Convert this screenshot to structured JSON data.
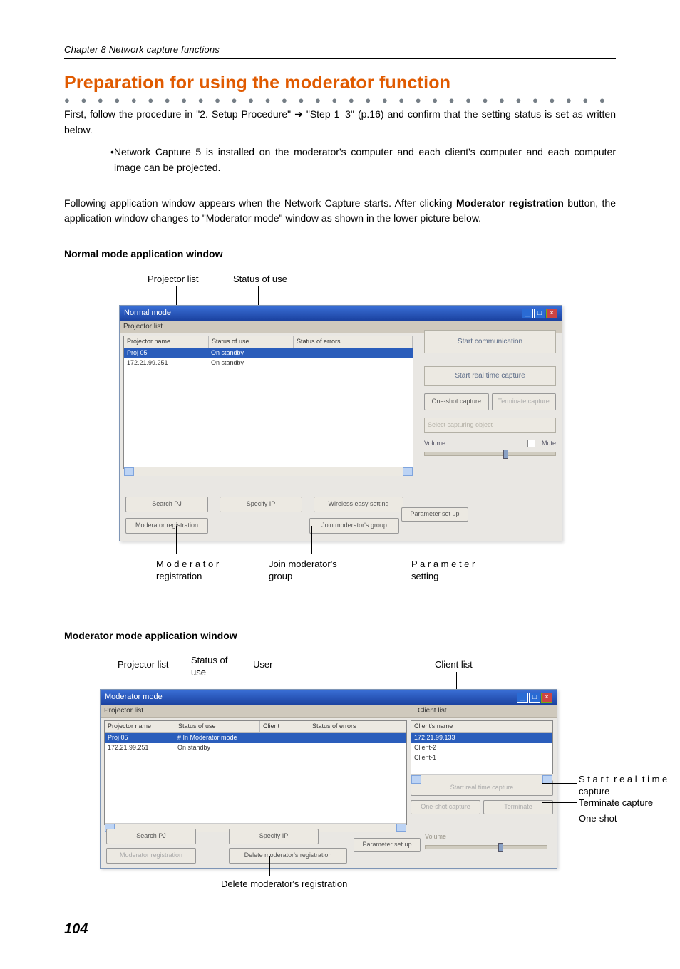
{
  "chapter": "Chapter 8 Network capture functions",
  "heading": "Preparation for using the moderator function",
  "para1_a": "First, follow the procedure in \"2. Setup Procedure\" ",
  "para1_b": " \"Step 1–3\" (p.16) and confirm that the setting status is set as written below.",
  "bullet1": "•Network Capture 5 is installed on the moderator's computer and each client's computer and each  computer image can be projected.",
  "para2": "Following application window appears when the Network Capture starts. After clicking Moderator registration button, the application window changes to \"Moderator mode\" window as shown in the lower picture below.",
  "para2_prefix": "Following application window appears when the Network Capture starts. After clicking ",
  "para2_bold": "Moderator registration",
  "para2_suffix": " button, the application window changes to \"Moderator mode\" window as shown in the lower picture below.",
  "sub_normal": "Normal mode application window",
  "sub_moderator": "Moderator mode application window",
  "callouts": {
    "projector_list": "Projector list",
    "status_of_use": "Status of use",
    "user": "User",
    "client_list": "Client list",
    "moderator_registration": "M o d e r a t o r\nregistration",
    "join_group": "Join moderator's\ngroup",
    "parameter_setting": "P a r a m e t e r\nsetting",
    "start_rt": "S t a r t  r e a l  t i m e\ncapture",
    "terminate": "Terminate capture",
    "one_shot": "One-shot",
    "delete_reg": "Delete moderator's registration"
  },
  "win_normal": {
    "title": "Normal mode",
    "section": "Projector list",
    "cols": [
      "Projector name",
      "Status of use",
      "Status of errors"
    ],
    "rows": [
      [
        "Proj 05",
        "On standby",
        ""
      ],
      [
        "172.21.99.251",
        "On standby",
        ""
      ]
    ],
    "right": {
      "start_comm": "Start communication",
      "start_rt": "Start real time capture",
      "one_shot": "One-shot capture",
      "terminate": "Terminate capture",
      "select_obj": "Select capturing object",
      "volume": "Volume",
      "mute": "Mute"
    },
    "bottom": {
      "search": "Search PJ",
      "specify": "Specify IP",
      "wireless": "Wireless easy setting",
      "mod_reg": "Moderator registration",
      "join": "Join moderator's group",
      "param": "Parameter set up"
    }
  },
  "win_mod": {
    "title": "Moderator mode",
    "section_pj": "Projector list",
    "section_cl": "Client list",
    "cols_pj": [
      "Projector name",
      "Status of use",
      "Client",
      "Status of errors"
    ],
    "rows_pj": [
      [
        "Proj 05",
        "# In Moderator mode",
        "",
        ""
      ],
      [
        "172.21.99.251",
        "On standby",
        "",
        ""
      ]
    ],
    "col_cl": "Client's name",
    "rows_cl": [
      "172.21.99.133",
      "Client-2",
      "Client-1"
    ],
    "right": {
      "start_rt": "Start real time capture",
      "one_shot": "One-shot capture",
      "terminate": "Terminate",
      "volume": "Volume"
    },
    "bottom": {
      "search": "Search PJ",
      "specify": "Specify IP",
      "mod_reg": "Moderator registration",
      "delete": "Delete moderator's registration",
      "param": "Parameter set up"
    }
  },
  "page_number": "104"
}
